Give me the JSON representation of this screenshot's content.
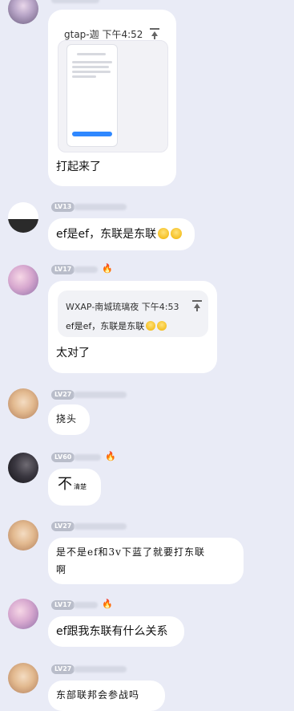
{
  "messages": {
    "m1": {
      "quote_header": "gtap-迦 下午4:52",
      "text": "打起来了"
    },
    "m2": {
      "level": "LV13",
      "text": "ef是ef，东联是东联"
    },
    "m3": {
      "level": "LV17",
      "quote_header": "WXAP-南城琉璃夜 下午4:53",
      "quote_text": "ef是ef，东联是东联",
      "text": "太对了"
    },
    "m4": {
      "level": "LV27",
      "text": "挠头"
    },
    "m5": {
      "level": "LV60",
      "text_big": "不",
      "text_small": "清楚"
    },
    "m6": {
      "level": "LV27",
      "line1": "是不是ef和3v下蓝了就要打东联",
      "line2": "啊"
    },
    "m7": {
      "level": "LV17",
      "text": "ef跟我东联有什么关系"
    },
    "m8": {
      "level": "LV27",
      "text": "东部联邦会参战吗"
    }
  },
  "icons": {
    "fire": "🔥",
    "emoji": "smiling-face"
  },
  "colors": {
    "background": "#e9ebf6",
    "bubble": "#ffffff",
    "level_badge": "#b9bdca",
    "fire": "#ff6a00"
  }
}
